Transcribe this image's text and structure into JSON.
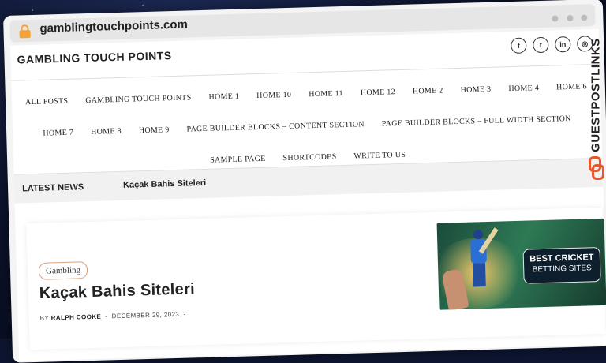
{
  "browser": {
    "url": "gamblingtouchpoints.com"
  },
  "site": {
    "title": "GAMBLING TOUCH POINTS",
    "social": [
      {
        "icon": "facebook-icon",
        "glyph": "f"
      },
      {
        "icon": "twitter-icon",
        "glyph": "t"
      },
      {
        "icon": "linkedin-icon",
        "glyph": "in"
      },
      {
        "icon": "instagram-icon",
        "glyph": "◎"
      }
    ]
  },
  "nav": {
    "rows": [
      [
        "ALL POSTS",
        "GAMBLING TOUCH POINTS",
        "HOME 1",
        "HOME 10",
        "HOME 11",
        "HOME 12",
        "HOME 2",
        "HOME 3",
        "HOME 4",
        "HOME 6"
      ],
      [
        "HOME 7",
        "HOME 8",
        "HOME 9",
        "PAGE BUILDER BLOCKS – CONTENT SECTION",
        "PAGE BUILDER BLOCKS – FULL WIDTH SECTION"
      ],
      [
        "SAMPLE PAGE",
        "SHORTCODES",
        "WRITE TO US"
      ]
    ]
  },
  "news": {
    "label": "LATEST NEWS",
    "item": "Kaçak Bahis Siteleri"
  },
  "post": {
    "category": "Gambling",
    "title": "Kaçak Bahis Siteleri",
    "by": "BY",
    "author": "RALPH COOKE",
    "sep": "-",
    "date": "DECEMBER 29, 2023",
    "sep2": "-",
    "image_line1": "BEST CRICKET",
    "image_line2": "BETTING SITES"
  },
  "watermark": {
    "text": "GUESTPOSTLINKS"
  },
  "colors": {
    "accent": "#e8582e",
    "lock": "#f2a23a",
    "category_border": "#d9a07a"
  }
}
